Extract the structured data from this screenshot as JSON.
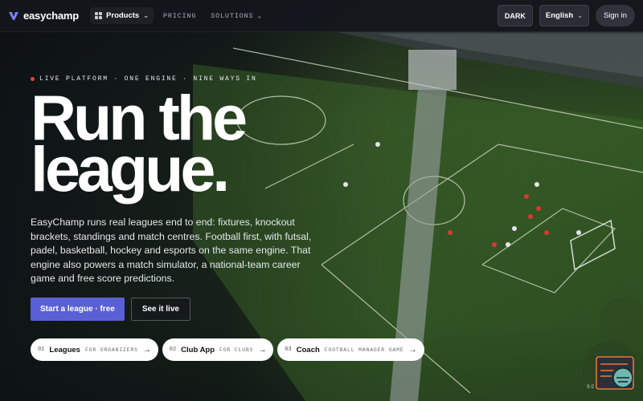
{
  "brand": {
    "name": "easychamp",
    "accent": "#5b5fd6",
    "logo_icon": "trophy-v-icon"
  },
  "nav": {
    "products_label": "Products",
    "pricing_label": "PRICING",
    "solutions_label": "SOLUTIONS"
  },
  "topbar_right": {
    "theme_label": "DARK",
    "language_selected": "English",
    "signin_label": "Sign in"
  },
  "hero": {
    "eyebrow": "LIVE PLATFORM · ONE ENGINE · NINE WAYS IN",
    "headline_line1": "Run the",
    "headline_line2": "league.",
    "lead": "EasyChamp runs real leagues end to end: fixtures, knockout brackets, standings and match centres. Football first, with futsal, padel, basketball, hockey and esports on the same engine. That engine also powers a match simulator, a national-team career game and free score predictions.",
    "primary_cta": "Start a league · free",
    "secondary_cta": "See it live"
  },
  "pills": [
    {
      "num": "01",
      "title": "Leagues",
      "sub": "FOR ORGANIZERS",
      "arrow": "→"
    },
    {
      "num": "02",
      "title": "Club App",
      "sub": "FOR CLUBS",
      "arrow": "→"
    },
    {
      "num": "03",
      "title": "Coach",
      "sub": "FOOTBALL MANAGER GAME",
      "arrow": "→"
    }
  ],
  "scroll_label": "SCROLL",
  "colors": {
    "primary_button": "#5b5fd6",
    "live_dot": "#e0453e",
    "topbar_bg": "#14161c"
  }
}
